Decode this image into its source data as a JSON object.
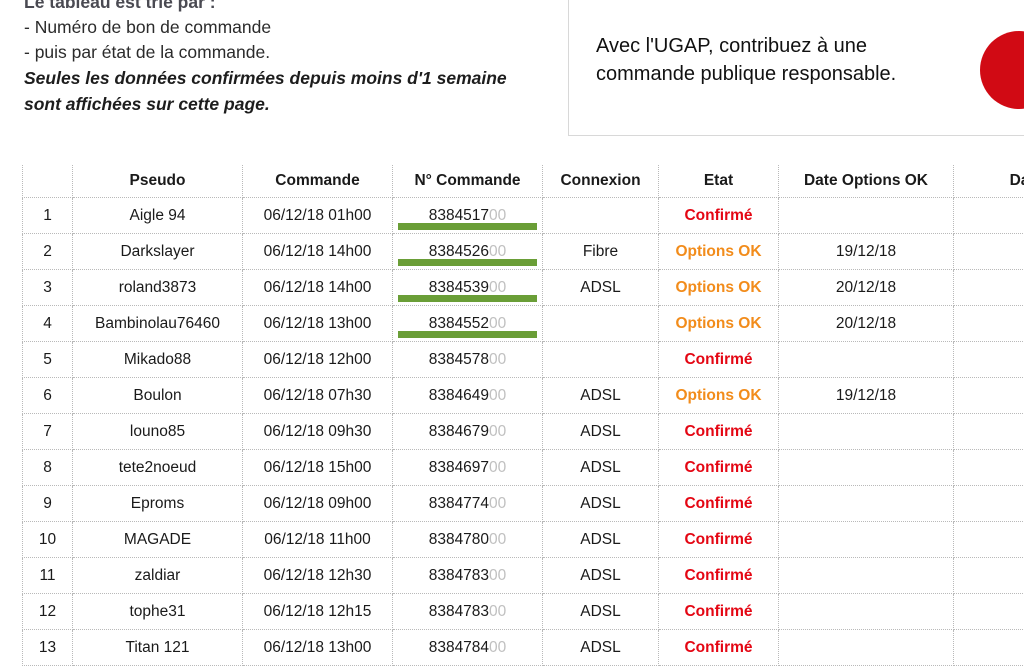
{
  "sort_info": {
    "title": "Le tableau est trié par :",
    "criteria": [
      "- Numéro de bon de commande",
      "- puis par état de la commande."
    ],
    "note_line1": "Seules les données confirmées depuis moins d'1 semaine",
    "note_line2": "sont affichées sur cette page."
  },
  "ad_banner": {
    "text": "Avec l'UGAP, contribuez à une commande publique responsable.",
    "circle_color": "#d10a14",
    "circle_icon": "red-circle-logo"
  },
  "table": {
    "headers": [
      "",
      "Pseudo",
      "Commande",
      "N° Commande",
      "Connexion",
      "Etat",
      "Date Options OK",
      "Date Ex"
    ],
    "colors": {
      "confirme": "#e40613",
      "options_ok": "#f28c1b",
      "highlight_bar": "#6a9e37",
      "number_tail": "#c0c0c0"
    },
    "rows": [
      {
        "index": "1",
        "pseudo": "Aigle 94",
        "commande": "06/12/18 01h00",
        "num_main": "8384517",
        "num_tail": "00",
        "highlighted": true,
        "connexion": "",
        "etat": "Confirmé",
        "etat_type": "confirme",
        "date_options_ok": "",
        "date_exp": ""
      },
      {
        "index": "2",
        "pseudo": "Darkslayer",
        "commande": "06/12/18 14h00",
        "num_main": "8384526",
        "num_tail": "00",
        "highlighted": true,
        "connexion": "Fibre",
        "etat": "Options OK",
        "etat_type": "options",
        "date_options_ok": "19/12/18",
        "date_exp": ""
      },
      {
        "index": "3",
        "pseudo": "roland3873",
        "commande": "06/12/18 14h00",
        "num_main": "8384539",
        "num_tail": "00",
        "highlighted": true,
        "connexion": "ADSL",
        "etat": "Options OK",
        "etat_type": "options",
        "date_options_ok": "20/12/18",
        "date_exp": ""
      },
      {
        "index": "4",
        "pseudo": "Bambinolau76460",
        "commande": "06/12/18 13h00",
        "num_main": "8384552",
        "num_tail": "00",
        "highlighted": true,
        "connexion": "",
        "etat": "Options OK",
        "etat_type": "options",
        "date_options_ok": "20/12/18",
        "date_exp": ""
      },
      {
        "index": "5",
        "pseudo": "Mikado88",
        "commande": "06/12/18 12h00",
        "num_main": "8384578",
        "num_tail": "00",
        "highlighted": false,
        "connexion": "",
        "etat": "Confirmé",
        "etat_type": "confirme",
        "date_options_ok": "",
        "date_exp": ""
      },
      {
        "index": "6",
        "pseudo": "Boulon",
        "commande": "06/12/18 07h30",
        "num_main": "8384649",
        "num_tail": "00",
        "highlighted": false,
        "connexion": "ADSL",
        "etat": "Options OK",
        "etat_type": "options",
        "date_options_ok": "19/12/18",
        "date_exp": ""
      },
      {
        "index": "7",
        "pseudo": "louno85",
        "commande": "06/12/18 09h30",
        "num_main": "8384679",
        "num_tail": "00",
        "highlighted": false,
        "connexion": "ADSL",
        "etat": "Confirmé",
        "etat_type": "confirme",
        "date_options_ok": "",
        "date_exp": ""
      },
      {
        "index": "8",
        "pseudo": "tete2noeud",
        "commande": "06/12/18 15h00",
        "num_main": "8384697",
        "num_tail": "00",
        "highlighted": false,
        "connexion": "ADSL",
        "etat": "Confirmé",
        "etat_type": "confirme",
        "date_options_ok": "",
        "date_exp": ""
      },
      {
        "index": "9",
        "pseudo": "Eproms",
        "commande": "06/12/18 09h00",
        "num_main": "8384774",
        "num_tail": "00",
        "highlighted": false,
        "connexion": "ADSL",
        "etat": "Confirmé",
        "etat_type": "confirme",
        "date_options_ok": "",
        "date_exp": ""
      },
      {
        "index": "10",
        "pseudo": "MAGADE",
        "commande": "06/12/18 11h00",
        "num_main": "8384780",
        "num_tail": "00",
        "highlighted": false,
        "connexion": "ADSL",
        "etat": "Confirmé",
        "etat_type": "confirme",
        "date_options_ok": "",
        "date_exp": ""
      },
      {
        "index": "11",
        "pseudo": "zaldiar",
        "commande": "06/12/18 12h30",
        "num_main": "8384783",
        "num_tail": "00",
        "highlighted": false,
        "connexion": "ADSL",
        "etat": "Confirmé",
        "etat_type": "confirme",
        "date_options_ok": "",
        "date_exp": ""
      },
      {
        "index": "12",
        "pseudo": "tophe31",
        "commande": "06/12/18 12h15",
        "num_main": "8384783",
        "num_tail": "00",
        "highlighted": false,
        "connexion": "ADSL",
        "etat": "Confirmé",
        "etat_type": "confirme",
        "date_options_ok": "",
        "date_exp": ""
      },
      {
        "index": "13",
        "pseudo": "Titan 121",
        "commande": "06/12/18 13h00",
        "num_main": "8384784",
        "num_tail": "00",
        "highlighted": false,
        "connexion": "ADSL",
        "etat": "Confirmé",
        "etat_type": "confirme",
        "date_options_ok": "",
        "date_exp": ""
      }
    ]
  }
}
